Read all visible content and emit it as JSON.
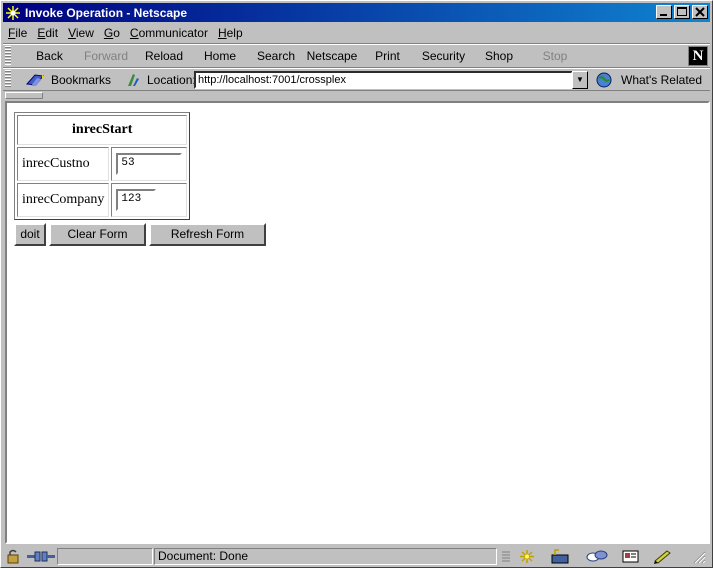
{
  "window": {
    "title": "Invoke Operation - Netscape"
  },
  "menu": [
    {
      "label": "File",
      "underline": "F",
      "rest": "ile"
    },
    {
      "label": "Edit",
      "underline": "E",
      "rest": "dit"
    },
    {
      "label": "View",
      "underline": "V",
      "rest": "iew"
    },
    {
      "label": "Go",
      "underline": "G",
      "rest": "o"
    },
    {
      "label": "Communicator",
      "underline": "C",
      "rest": "ommunicator"
    },
    {
      "label": "Help",
      "underline": "H",
      "rest": "elp"
    }
  ],
  "nav": {
    "back": "Back",
    "forward": "Forward",
    "reload": "Reload",
    "home": "Home",
    "search": "Search",
    "netscape": "Netscape",
    "print": "Print",
    "security": "Security",
    "shop": "Shop",
    "stop": "Stop"
  },
  "location": {
    "bookmarks": "Bookmarks",
    "label": "Location:",
    "url": "http://localhost:7001/crossplex",
    "related": "What's Related"
  },
  "form": {
    "header": "inrecStart",
    "rows": [
      {
        "label": "inrecCustno",
        "value": "53"
      },
      {
        "label": "inrecCompany",
        "value": "123"
      }
    ],
    "doit": "doit",
    "clear": "Clear Form",
    "refresh": "Refresh Form"
  },
  "status": {
    "text": "Document: Done"
  },
  "icons": {
    "title": "netscape-star-icon",
    "logo": "netscape-n-logo",
    "lock": "lock-icon",
    "connection": "connection-plug-icon"
  }
}
